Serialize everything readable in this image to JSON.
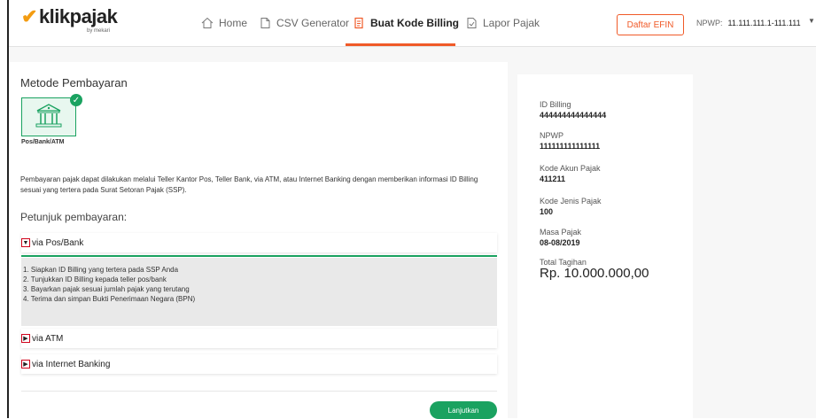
{
  "header": {
    "logo": "klikpajak",
    "logo_sub": "by mekari",
    "nav": [
      {
        "label": "Home",
        "icon": "home-icon"
      },
      {
        "label": "CSV Generator",
        "icon": "file-icon"
      },
      {
        "label": "Buat Kode Billing",
        "icon": "billing-icon"
      },
      {
        "label": "Lapor Pajak",
        "icon": "report-icon"
      }
    ],
    "efin_button": "Daftar EFIN",
    "npwp_label": "NPWP:",
    "npwp_value": "11.111.111.1-111.111"
  },
  "main": {
    "title": "Metode Pembayaran",
    "method_label": "Pos/Bank/ATM",
    "description": "Pembayaran pajak dapat dilakukan melalui Teller Kantor Pos, Teller Bank, via ATM, atau Internet Banking dengan memberikan informasi ID Billing sesuai yang tertera pada Surat Setoran Pajak (SSP).",
    "instructions_title": "Petunjuk pembayaran:",
    "accordions": [
      {
        "label": "via Pos/Bank"
      },
      {
        "label": "via ATM"
      },
      {
        "label": "via Internet Banking"
      }
    ],
    "steps": [
      "1. Siapkan ID Billing yang tertera pada SSP Anda",
      "2. Tunjukkan ID Billing kepada teller pos/bank",
      "3. Bayarkan pajak sesuai jumlah pajak yang terutang",
      "4. Terima dan simpan Bukti Penerimaan Negara (BPN)"
    ],
    "next_button": "Lanjutkan"
  },
  "summary": {
    "id_billing_label": "ID Billing",
    "id_billing_value": "444444444444444",
    "npwp_label": "NPWP",
    "npwp_value": "111111111111111",
    "kode_akun_label": "Kode Akun Pajak",
    "kode_akun_value": "411211",
    "kode_jenis_label": "Kode Jenis Pajak",
    "kode_jenis_value": "100",
    "masa_label": "Masa Pajak",
    "masa_value": "08-08/2019",
    "total_label": "Total Tagihan",
    "total_value": "Rp. 10.000.000,00"
  },
  "colors": {
    "accent": "#f05a28",
    "brand_green": "#1aa260"
  }
}
